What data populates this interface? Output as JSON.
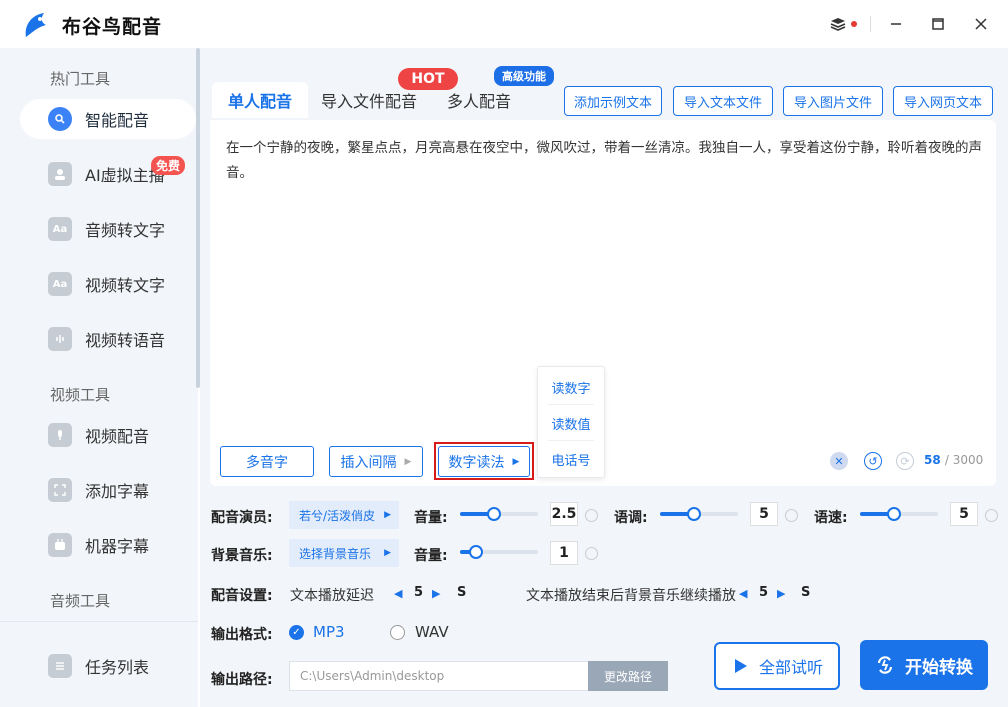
{
  "app": {
    "title": "布谷鸟配音"
  },
  "sidebar": {
    "sections": [
      "热门工具",
      "视频工具",
      "音频工具"
    ],
    "items": [
      {
        "label": "智能配音",
        "icon": "smart-dub-icon"
      },
      {
        "label": "AI虚拟主播",
        "icon": "virtual-anchor-icon"
      },
      {
        "label": "音频转文字",
        "icon": "audio-to-text-icon"
      },
      {
        "label": "视频转文字",
        "icon": "video-to-text-icon"
      },
      {
        "label": "视频转语音",
        "icon": "video-to-voice-icon"
      },
      {
        "label": "视频配音",
        "icon": "video-dub-icon"
      },
      {
        "label": "添加字幕",
        "icon": "add-subtitle-icon"
      },
      {
        "label": "机器字幕",
        "icon": "machine-subtitle-icon"
      },
      {
        "label": "任务列表",
        "icon": "task-list-icon"
      }
    ],
    "free_badge": "免费"
  },
  "tabs": {
    "single": "单人配音",
    "import_file": "导入文件配音",
    "multi": "多人配音",
    "hot_tag": "HOT",
    "adv_tag": "高级功能"
  },
  "toolbar": {
    "add_sample": "添加示例文本",
    "import_text": "导入文本文件",
    "import_image": "导入图片文件",
    "import_web": "导入网页文本"
  },
  "editor": {
    "text": "在一个宁静的夜晚，繁星点点，月亮高悬在夜空中，微风吹过，带着一丝清凉。我独自一人，享受着这份宁静，聆听着夜晚的声音。",
    "polyphone": "多音字",
    "insert_pause": "插入间隔",
    "number_read": "数字读法",
    "count": "58",
    "max": "/ 3000"
  },
  "number_menu": [
    "读数字",
    "读数值",
    "电话号"
  ],
  "settings": {
    "voice_label": "配音演员:",
    "voice_value": "若兮/活泼俏皮",
    "volume_label": "音量:",
    "volume_value": "2.5",
    "pitch_label": "语调:",
    "pitch_value": "5",
    "speed_label": "语速:",
    "speed_value": "5",
    "bgm_label": "背景音乐:",
    "bgm_value": "选择背景音乐",
    "bgm_volume_label": "音量:",
    "bgm_volume_value": "1",
    "dub_settings_label": "配音设置:",
    "delay_label": "文本播放延迟",
    "delay_value": "5",
    "delay_unit": "S",
    "continue_label": "文本播放结束后背景音乐继续播放",
    "continue_value": "5",
    "continue_unit": "S",
    "format_label": "输出格式:",
    "format_mp3": "MP3",
    "format_wav": "WAV",
    "path_label": "输出路径:",
    "path_value": "C:\\Users\\Admin\\desktop",
    "change_path": "更改路径"
  },
  "actions": {
    "preview_all": "全部试听",
    "start": "开始转换"
  },
  "colors": {
    "accent": "#1a73e8",
    "hot": "#ef4444",
    "sidebar_bg": "#f2f5f9"
  }
}
